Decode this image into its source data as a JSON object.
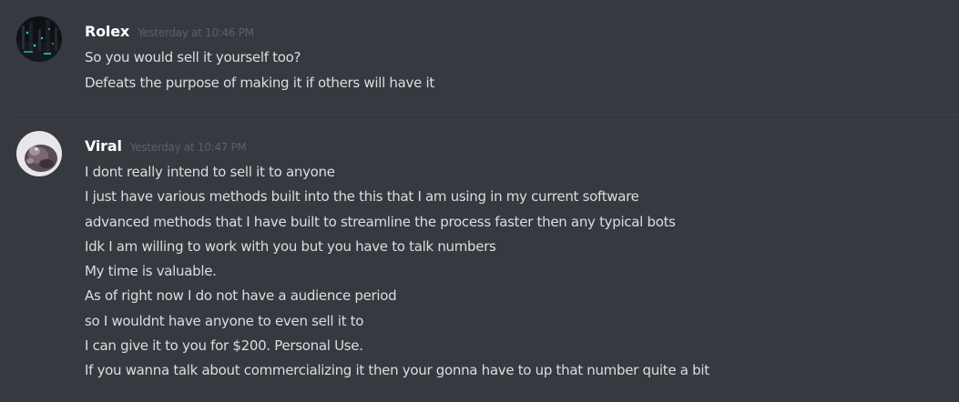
{
  "messages": [
    {
      "username": "Rolex",
      "timestamp": "Yesterday at 10:46 PM",
      "lines": [
        "So you would sell it yourself too?",
        "Defeats the purpose of making it if others will have it"
      ]
    },
    {
      "username": "Viral",
      "timestamp": "Yesterday at 10:47 PM",
      "lines": [
        "I dont really intend to sell it to anyone",
        "I just have various methods built into the this that I am using in my current software",
        "advanced methods that I have built to streamline the process faster then any typical bots",
        "Idk I am willing to work with you but you have to talk numbers",
        "My time is valuable.",
        "As of right now I do not have a audience period",
        "so I wouldnt have anyone to even sell it to",
        "I can give it to you for $200. Personal Use.",
        "If you wanna talk about commercializing it then your gonna have to up that number quite a bit"
      ]
    }
  ],
  "colors": {
    "background": "#36393f",
    "username": "#ffffff",
    "timestamp": "#5d6067",
    "message_text": "#dcddde",
    "divider": "#3f4248"
  }
}
